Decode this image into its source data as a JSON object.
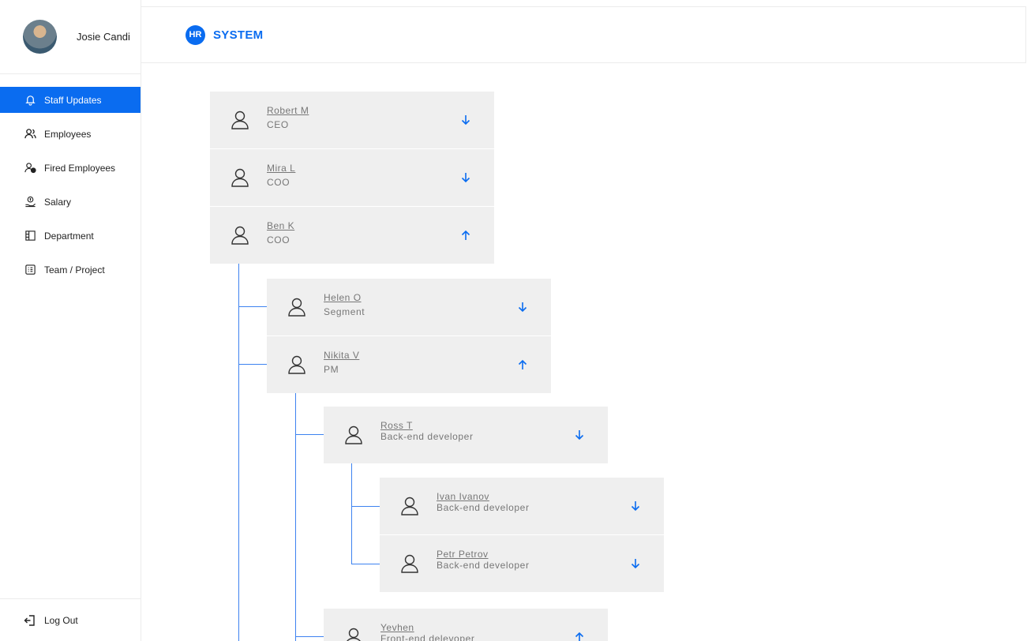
{
  "profile": {
    "name": "Josie Candi"
  },
  "sidebar": {
    "items": [
      {
        "label": "Staff Updates",
        "icon": "bell-icon"
      },
      {
        "label": "Employees",
        "icon": "users-icon"
      },
      {
        "label": "Fired Employees",
        "icon": "user-removed-icon"
      },
      {
        "label": "Salary",
        "icon": "salary-icon"
      },
      {
        "label": "Department",
        "icon": "building-icon"
      },
      {
        "label": "Team / Project",
        "icon": "list-icon"
      }
    ],
    "active_index": 0,
    "logout_label": "Log Out"
  },
  "header": {
    "badge": "HR",
    "title": "SYSTEM"
  },
  "tree": {
    "cards": [
      {
        "name": "Robert M",
        "role": "CEO",
        "direction": "down"
      },
      {
        "name": "Mira L",
        "role": "COO",
        "direction": "down"
      },
      {
        "name": "Ben K",
        "role": "COO",
        "direction": "up"
      },
      {
        "name": "Helen O",
        "role": "Segment",
        "direction": "down"
      },
      {
        "name": "Nikita V",
        "role": "PM",
        "direction": "up"
      },
      {
        "name": "Ross T",
        "role": "Back-end developer",
        "direction": "down"
      },
      {
        "name": "Ivan Ivanov",
        "role": "Back-end developer",
        "direction": "down"
      },
      {
        "name": "Petr Petrov",
        "role": "Back-end developer",
        "direction": "down"
      },
      {
        "name": "Yevhen",
        "role": "Front-end delevoper",
        "direction": "up"
      }
    ]
  },
  "colors": {
    "accent": "#0a6cf0",
    "card_bg": "#efefef",
    "connector": "#3d82f0"
  }
}
